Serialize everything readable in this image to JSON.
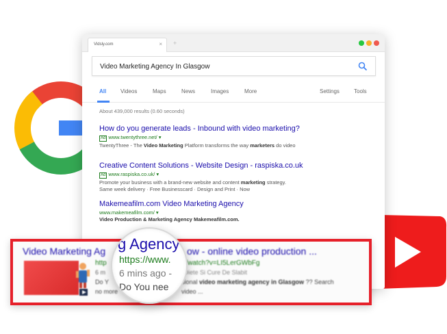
{
  "browser": {
    "tab_title": "Vidsly.com",
    "tab_close": "×",
    "new_tab": "+",
    "window_dots": [
      "#25c73f",
      "#f7b02b",
      "#f05a4f"
    ]
  },
  "search": {
    "query": "Video Marketing Agency In Glasgow"
  },
  "nav": {
    "all": "All",
    "videos": "Videos",
    "maps": "Maps",
    "news": "News",
    "images": "Images",
    "more": "More",
    "settings": "Settings",
    "tools": "Tools"
  },
  "stats": "About 439,000 results (0.60 seconds)",
  "results": [
    {
      "title": "How do you generate leads - Inbound with video marketing?",
      "ad": "Ad",
      "url": "www.twentythree.net/ ▾",
      "desc_prefix": "TwentyThree - The ",
      "desc_bold": "Video Marketing",
      "desc_mid": " Platform transforms the way ",
      "desc_bold2": "marketers",
      "desc_suffix": " do video"
    },
    {
      "title": "Creative Content Solutions - Website Design - raspiska.co.uk",
      "ad": "Ad",
      "url": "www.raspiska.co.uk/ ▾",
      "desc_prefix": "Promote your business with a brand-new website and content ",
      "desc_bold": "marketing",
      "desc_suffix": " strategy.",
      "line2": "Same week delivery · Free Businesscard · Design and Print · Now"
    },
    {
      "title": "Makemeafilm.com Video Marketing Agency",
      "url": "www.makemeafilm.com/ ▾",
      "desc_prefix": "Video Production & Marketing ",
      "desc_bold": "Agency",
      "desc_suffix": " Makemeafilm.com."
    }
  ],
  "highlight": {
    "title_left": "Video Marketing Ag",
    "title_right": "ow - online video production ...",
    "url_prefix": "http",
    "url": "m/watch?v=LI5LerGWbFg",
    "time_prefix": "6 m",
    "time": "- Diete Si Cure De Slabit",
    "desc_prefix": "Do Y",
    "desc_mid": "sional ",
    "desc_bold": "video marketing agency in Glasgow",
    "desc_suffix": " ?? Search",
    "more_prefix": "no more",
    "more_suffix": "video ..."
  },
  "lens": {
    "title": "g Agency",
    "url": "https://www.",
    "time": "6 mins ago - ",
    "desc": "Do You nee"
  }
}
